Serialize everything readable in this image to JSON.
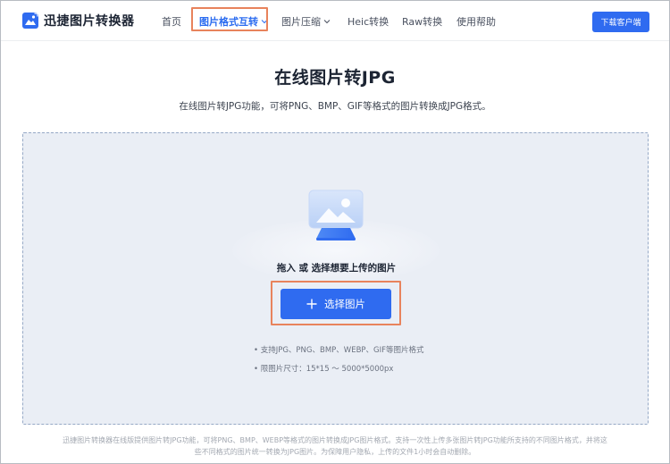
{
  "header": {
    "logo_text": "迅捷图片转换器",
    "nav": [
      {
        "label": "首页"
      },
      {
        "label": "图片格式互转"
      },
      {
        "label": "图片压缩"
      },
      {
        "label": "Heic转换"
      },
      {
        "label": "Raw转换"
      },
      {
        "label": "使用帮助"
      }
    ],
    "download_label": "下载客户端"
  },
  "main": {
    "title": "在线图片转JPG",
    "subtitle": "在线图片转JPG功能，可将PNG、BMP、GIF等格式的图片转换成JPG格式。",
    "upload": {
      "drag_text": "拖入 或 选择想要上传的图片",
      "select_label": "选择图片",
      "note_formats": "• 支持JPG、PNG、BMP、WEBP、GIF等图片格式",
      "note_size": "• 限图片尺寸：15*15 ～ 5000*5000px"
    }
  },
  "footer": {
    "line1": "迅捷图片转换器在线版提供图片转JPG功能，可将PNG、BMP、WEBP等格式的图片转换成JPG图片格式。支持一次性上传多张图片转JPG功能所支持的不同图片格式，并将这",
    "line2": "些不同格式的图片统一转换为JPG图片。为保障用户隐私，上传的文件1小时会自动删除。"
  },
  "colors": {
    "accent": "#2f6bf0",
    "highlight": "#e8835c",
    "dropzone_bg": "#eaeef5"
  }
}
